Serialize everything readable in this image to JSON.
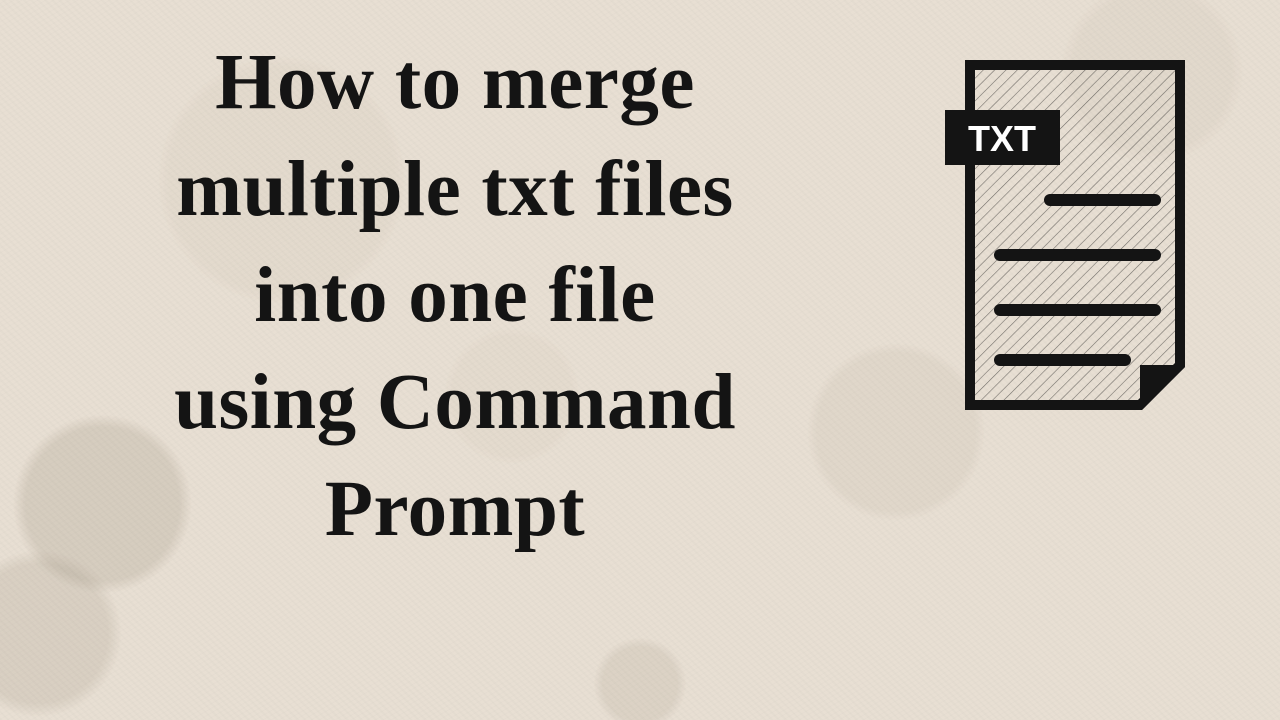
{
  "title": {
    "line1": "How to merge",
    "line2": "multiple txt files",
    "line3": "into one file",
    "line4": "using Command",
    "line5": "Prompt"
  },
  "icon": {
    "badge_text": "TXT"
  }
}
